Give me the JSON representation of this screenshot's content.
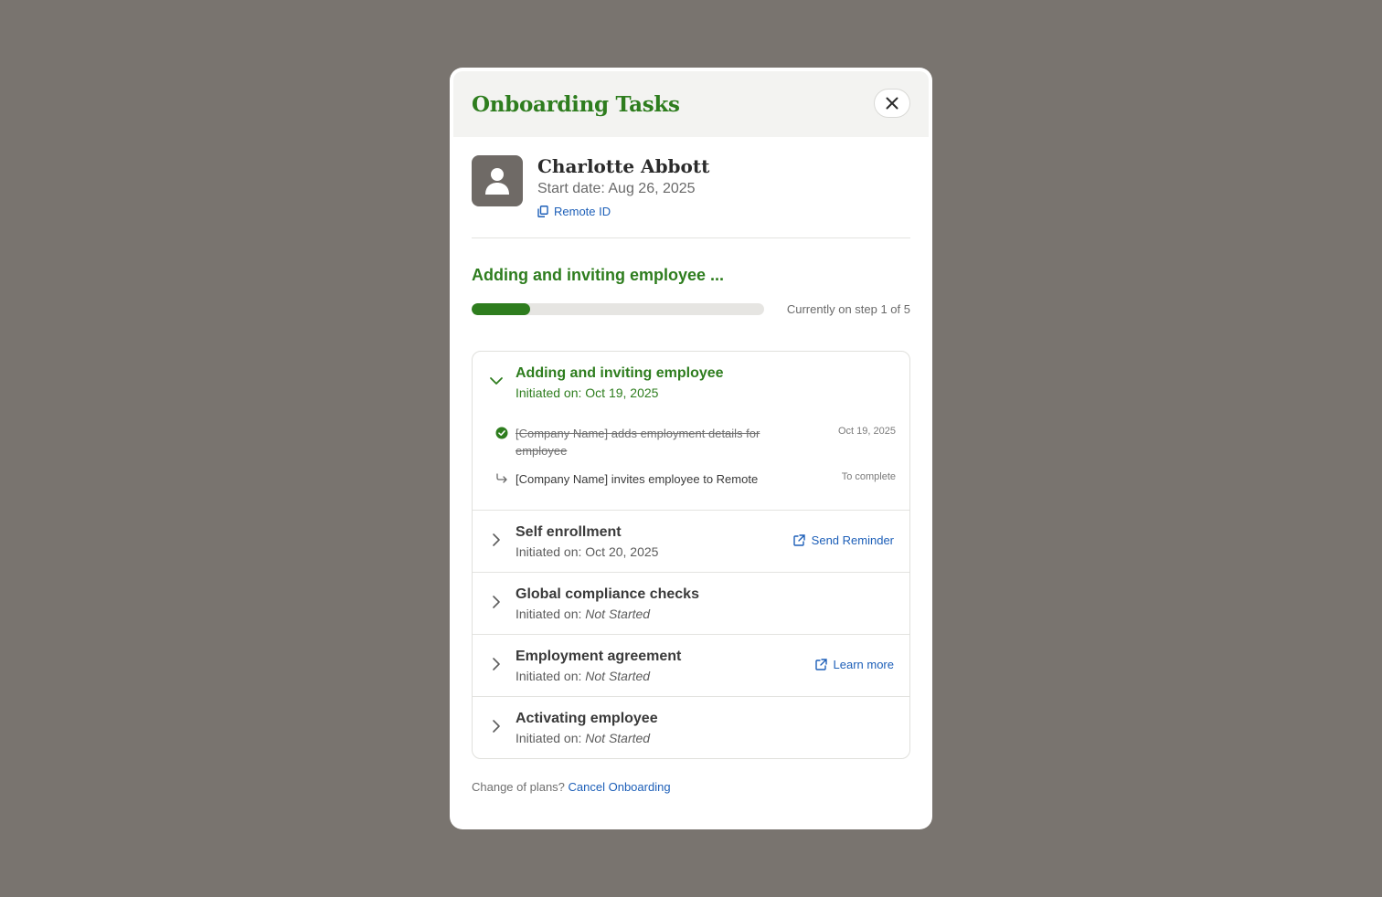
{
  "modal": {
    "title": "Onboarding Tasks",
    "close_icon": "close-icon"
  },
  "employee": {
    "name": "Charlotte Abbott",
    "start_date": "Start date: Aug 26, 2025",
    "remote_id_label": "Remote ID",
    "avatar_icon": "person-icon"
  },
  "progress": {
    "title": "Adding and inviting employee ...",
    "fraction": 0.2,
    "status_text": "Currently on step 1 of 5",
    "color": "#2e7d1e"
  },
  "steps": [
    {
      "title": "Adding and inviting employee",
      "initiated_prefix": "Initiated on: ",
      "initiated_value": "Oct 19, 2025",
      "expanded": true,
      "subtasks": [
        {
          "text": "[Company Name] adds employment details for employee",
          "meta": "Oct 19, 2025",
          "done": true,
          "icon": "check-circle-icon"
        },
        {
          "text": "[Company Name] invites employee to Remote",
          "meta": "To complete",
          "done": false,
          "icon": "arrow-return-icon"
        }
      ]
    },
    {
      "title": "Self enrollment",
      "initiated_prefix": "Initiated on: ",
      "initiated_value": "Oct 20, 2025",
      "action": "Send Reminder",
      "action_icon": "external-link-icon"
    },
    {
      "title": "Global compliance checks",
      "initiated_prefix": "Initiated on: ",
      "initiated_value": "Not Started"
    },
    {
      "title": "Employment agreement",
      "initiated_prefix": "Initiated on: ",
      "initiated_value": "Not Started",
      "action": "Learn more",
      "action_icon": "external-link-icon"
    },
    {
      "title": "Activating employee",
      "initiated_prefix": "Initiated on: ",
      "initiated_value": "Not Started"
    }
  ],
  "footer": {
    "prompt": "Change of plans? ",
    "link": "Cancel Onboarding"
  },
  "colors": {
    "backdrop": "#79746f",
    "accent_green": "#2e7d1e",
    "link_blue": "#1d5fb8"
  }
}
